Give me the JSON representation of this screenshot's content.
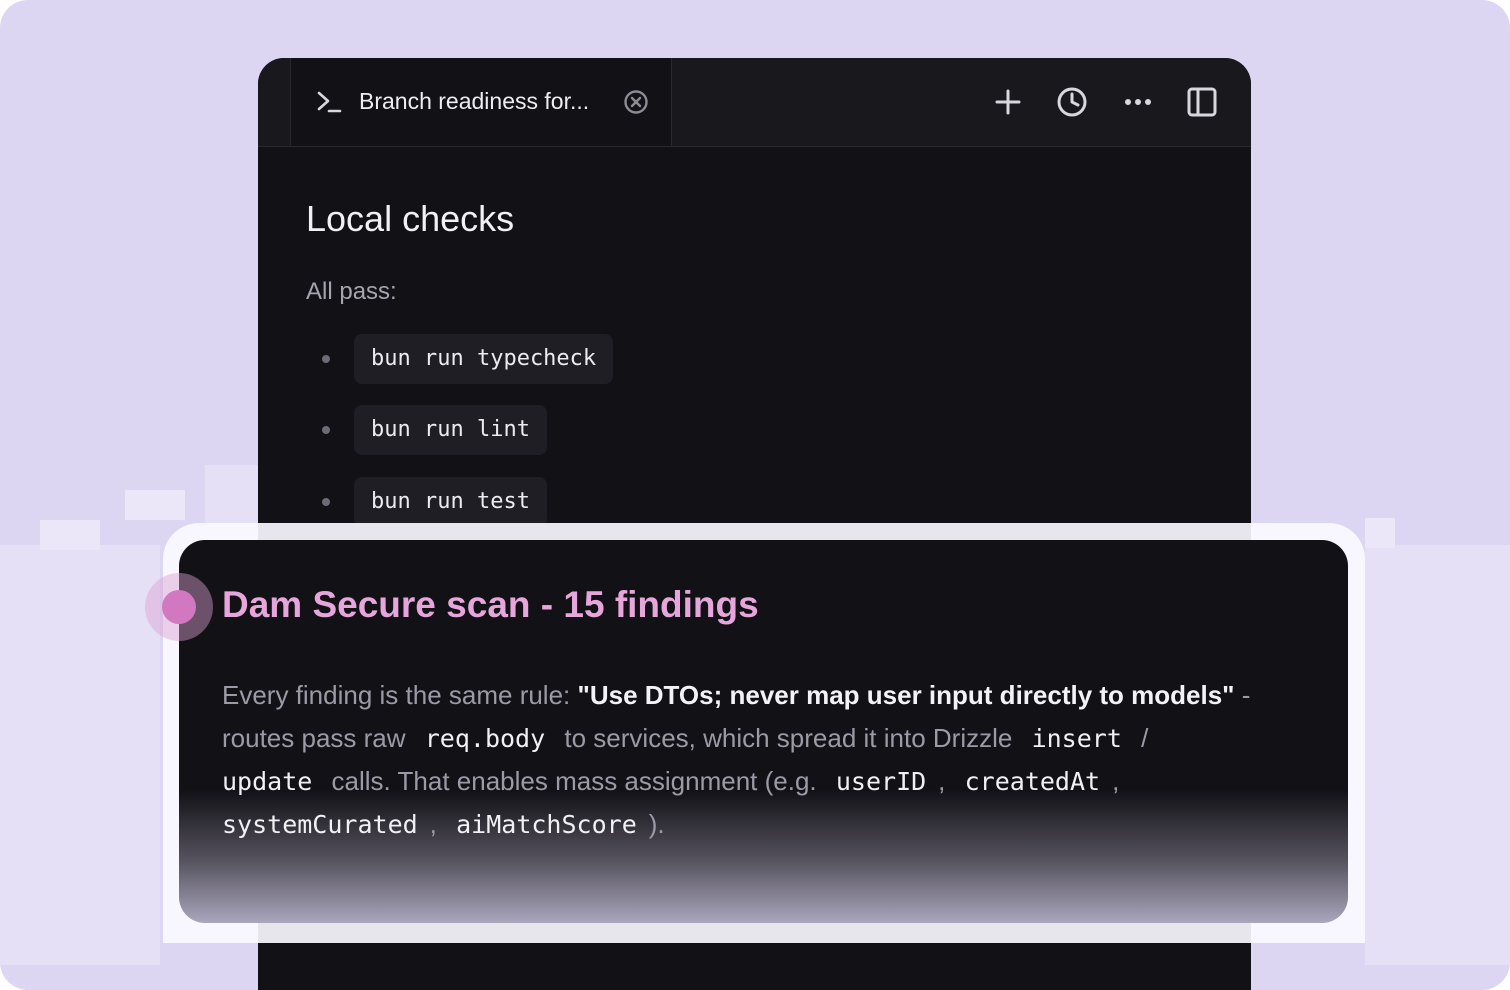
{
  "tab": {
    "title": "Branch readiness for..."
  },
  "toolbar": {
    "icons": [
      "plus-icon",
      "history-icon",
      "more-icon",
      "sidebar-toggle-icon"
    ]
  },
  "section": {
    "title": "Local checks",
    "subtitle": "All pass:",
    "items": [
      "bun run typecheck",
      "bun run lint",
      "bun run test"
    ]
  },
  "card": {
    "title": "Dam Secure scan - 15 findings",
    "p1": "Every finding is the same rule: ",
    "rule": "\"Use DTOs; never map user input directly to models\"",
    "p2": " - routes pass raw ",
    "c1": "req.body",
    "p3": " to services, which spread it into Drizzle ",
    "c2": "insert",
    "p4": " / ",
    "c3": "update",
    "p5": " calls. That enables mass assignment (e.g. ",
    "c4": "userID",
    "p6": ", ",
    "c5": "createdAt",
    "p7": ", ",
    "c6": "systemCurated",
    "p8": ", ",
    "c7": "aiMatchScore",
    "p9": ")."
  },
  "colors": {
    "accent": "#e6a6dc",
    "dot": "#d178c1",
    "background": "#dcd6f2",
    "panel": "#121116"
  }
}
